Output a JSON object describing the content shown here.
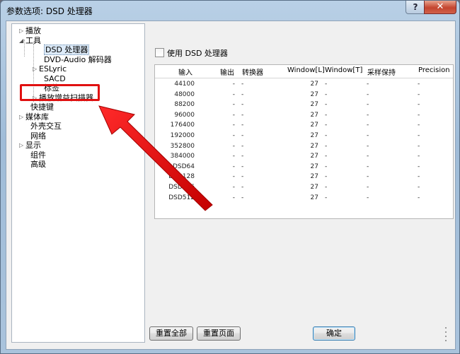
{
  "window": {
    "title": "参数选项: DSD 处理器",
    "help_label": "?",
    "close_label": "✕"
  },
  "tree": {
    "items": [
      {
        "label": "播放",
        "expander": "▷"
      },
      {
        "label": "工具",
        "expander": "◢"
      },
      {
        "label": "DSD 处理器",
        "expander": ""
      },
      {
        "label": "DVD-Audio 解码器",
        "expander": ""
      },
      {
        "label": "ESLyric",
        "expander": "▷"
      },
      {
        "label": "SACD",
        "expander": ""
      },
      {
        "label": "标签",
        "expander": ""
      },
      {
        "label": "播放增益扫描器",
        "expander": "▷"
      },
      {
        "label": "快捷键",
        "expander": ""
      },
      {
        "label": "媒体库",
        "expander": "▷"
      },
      {
        "label": "外壳交互",
        "expander": ""
      },
      {
        "label": "网络",
        "expander": ""
      },
      {
        "label": "显示",
        "expander": "▷"
      },
      {
        "label": "组件",
        "expander": ""
      },
      {
        "label": "高级",
        "expander": ""
      }
    ]
  },
  "checkbox": {
    "label": "使用 DSD 处理器"
  },
  "table": {
    "columns": [
      "输入",
      "输出",
      "转换器",
      "Window[L]",
      "Window[T]",
      "采样保持",
      "Precision"
    ],
    "rows": [
      [
        "44100",
        "-",
        "-",
        "27",
        "-",
        "-",
        "-"
      ],
      [
        "48000",
        "-",
        "-",
        "27",
        "-",
        "-",
        "-"
      ],
      [
        "88200",
        "-",
        "-",
        "27",
        "-",
        "-",
        "-"
      ],
      [
        "96000",
        "-",
        "-",
        "27",
        "-",
        "-",
        "-"
      ],
      [
        "176400",
        "-",
        "-",
        "27",
        "-",
        "-",
        "-"
      ],
      [
        "192000",
        "-",
        "-",
        "27",
        "-",
        "-",
        "-"
      ],
      [
        "352800",
        "-",
        "-",
        "27",
        "-",
        "-",
        "-"
      ],
      [
        "384000",
        "-",
        "-",
        "27",
        "-",
        "-",
        "-"
      ],
      [
        "DSD64",
        "-",
        "-",
        "27",
        "-",
        "-",
        "-"
      ],
      [
        "DSD128",
        "-",
        "-",
        "27",
        "-",
        "-",
        "-"
      ],
      [
        "DSD256",
        "-",
        "-",
        "27",
        "-",
        "-",
        "-"
      ],
      [
        "DSD512",
        "-",
        "-",
        "27",
        "-",
        "-",
        "-"
      ]
    ]
  },
  "buttons": {
    "reset_all": "重置全部",
    "reset_page": "重置页面",
    "ok": "确定"
  },
  "colors": {
    "annotation": "#e01010",
    "selection": "#dceaf8"
  }
}
